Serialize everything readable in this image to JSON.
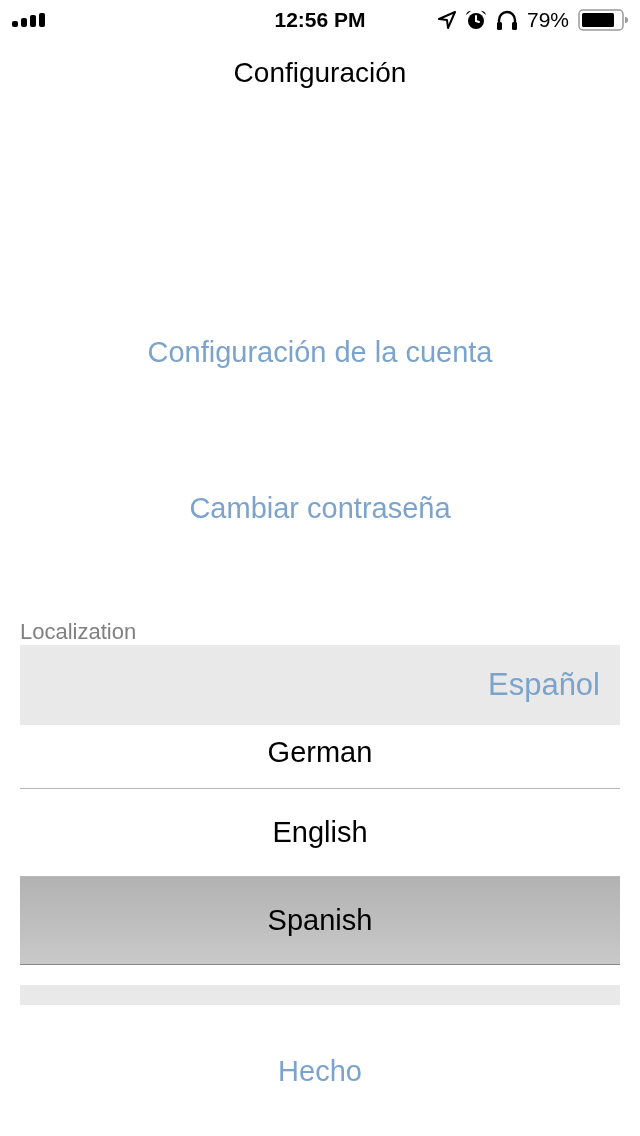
{
  "status_bar": {
    "time": "12:56 PM",
    "battery_percent": "79%"
  },
  "header": {
    "title": "Configuración"
  },
  "menu_links": [
    "Configuración de la cuenta",
    "Cambiar contraseña"
  ],
  "localization": {
    "label": "Localization",
    "value": "Español",
    "options": [
      {
        "label": "German",
        "selected": false
      },
      {
        "label": "English",
        "selected": false
      },
      {
        "label": "Spanish",
        "selected": true
      }
    ]
  },
  "done_button": {
    "label": "Hecho"
  }
}
